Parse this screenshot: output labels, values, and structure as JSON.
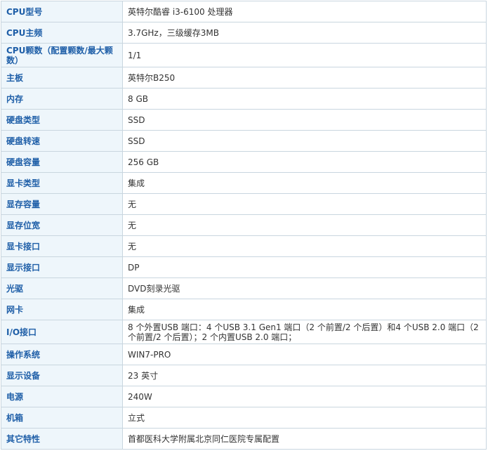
{
  "specs": [
    {
      "label": "CPU型号",
      "value": "英特尔酷睿 i3-6100 处理器"
    },
    {
      "label": "CPU主频",
      "value": "3.7GHz，三级缓存3MB"
    },
    {
      "label": "CPU颗数（配置颗数/最大颗数）",
      "value": "1/1"
    },
    {
      "label": "主板",
      "value": "英特尔B250"
    },
    {
      "label": "内存",
      "value": "8  GB"
    },
    {
      "label": "硬盘类型",
      "value": "SSD"
    },
    {
      "label": "硬盘转速",
      "value": "SSD"
    },
    {
      "label": "硬盘容量",
      "value": "256  GB"
    },
    {
      "label": "显卡类型",
      "value": "集成"
    },
    {
      "label": "显存容量",
      "value": "无"
    },
    {
      "label": "显存位宽",
      "value": "无"
    },
    {
      "label": "显卡接口",
      "value": "无"
    },
    {
      "label": "显示接口",
      "value": "DP"
    },
    {
      "label": "光驱",
      "value": "DVD刻录光驱"
    },
    {
      "label": "网卡",
      "value": "集成"
    },
    {
      "label": "I/O接口",
      "value": "8 个外置USB 端口：4 个USB 3.1 Gen1 端口（2 个前置/2 个后置）和4 个USB 2.0 端口（2 个前置/2 个后置）；2 个内置USB 2.0 端口；"
    },
    {
      "label": "操作系统",
      "value": "WIN7-PRO"
    },
    {
      "label": "显示设备",
      "value": "23  英寸"
    },
    {
      "label": "电源",
      "value": "240W"
    },
    {
      "label": "机箱",
      "value": "立式"
    },
    {
      "label": "其它特性",
      "value": "首都医科大学附属北京同仁医院专属配置"
    }
  ],
  "colors": {
    "label_text": "#1f5fa8",
    "label_bg": "#eef6fb",
    "border": "#c9d6df",
    "value_text": "#333333"
  }
}
